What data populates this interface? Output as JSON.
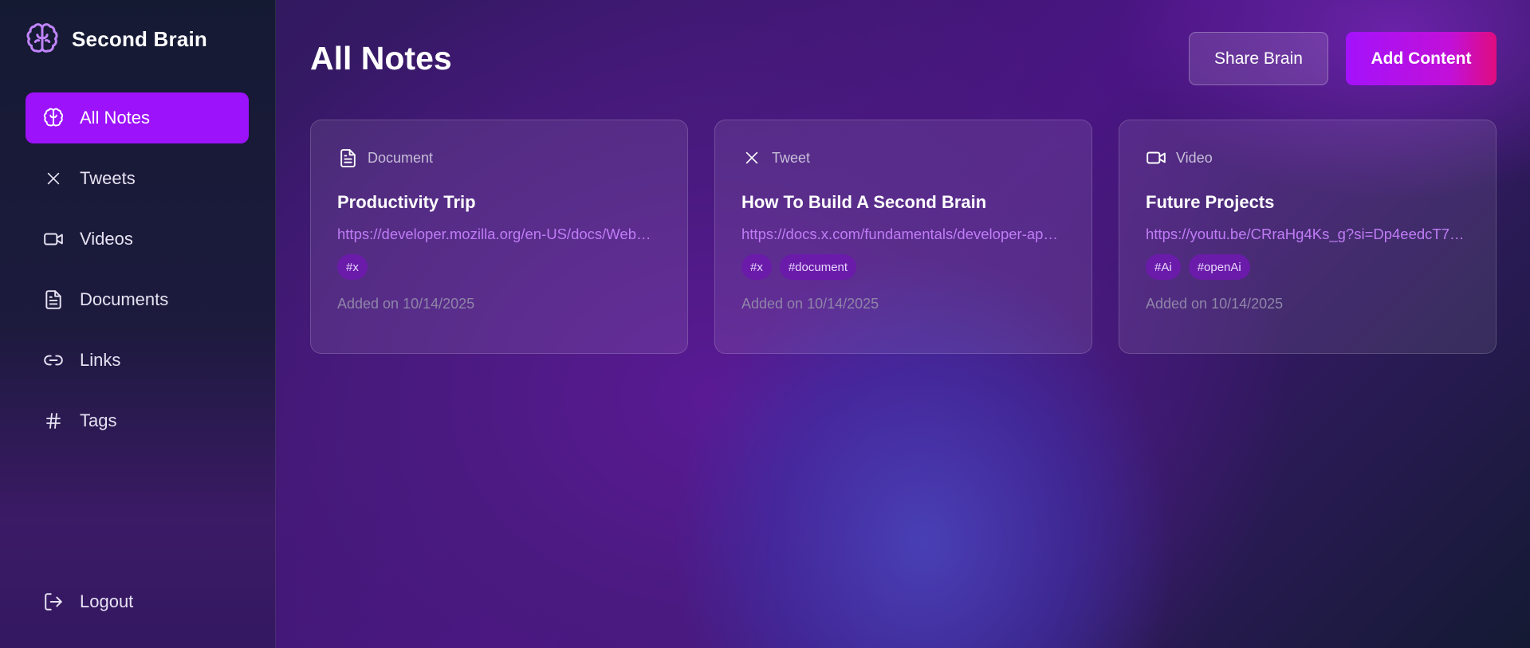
{
  "brand": {
    "title": "Second Brain",
    "icon": "brain-icon"
  },
  "sidebar": {
    "items": [
      {
        "label": "All Notes",
        "icon": "brain-icon",
        "active": true
      },
      {
        "label": "Tweets",
        "icon": "x-icon"
      },
      {
        "label": "Videos",
        "icon": "video-icon"
      },
      {
        "label": "Documents",
        "icon": "document-icon"
      },
      {
        "label": "Links",
        "icon": "link-icon"
      },
      {
        "label": "Tags",
        "icon": "hash-icon"
      }
    ],
    "logout": {
      "label": "Logout",
      "icon": "logout-icon"
    }
  },
  "header": {
    "title": "All Notes",
    "share_label": "Share Brain",
    "add_label": "Add Content"
  },
  "cards": [
    {
      "type": "Document",
      "icon": "document-icon",
      "title": "Productivity Trip",
      "link": "https://developer.mozilla.org/en-US/docs/Web…",
      "tags": [
        "#x"
      ],
      "date": "Added on 10/14/2025"
    },
    {
      "type": "Tweet",
      "icon": "x-icon",
      "title": "How To Build A Second Brain",
      "link": "https://docs.x.com/fundamentals/developer-ap…",
      "tags": [
        "#x",
        "#document"
      ],
      "date": "Added on 10/14/2025"
    },
    {
      "type": "Video",
      "icon": "video-icon",
      "title": "Future Projects",
      "link": "https://youtu.be/CRraHg4Ks_g?si=Dp4eedcT7F…",
      "tags": [
        "#Ai",
        "#openAi"
      ],
      "date": "Added on 10/14/2025"
    }
  ],
  "colors": {
    "accent": "#9b12fb",
    "link": "#c07cf6",
    "tag_bg": "#6a1ba9"
  }
}
